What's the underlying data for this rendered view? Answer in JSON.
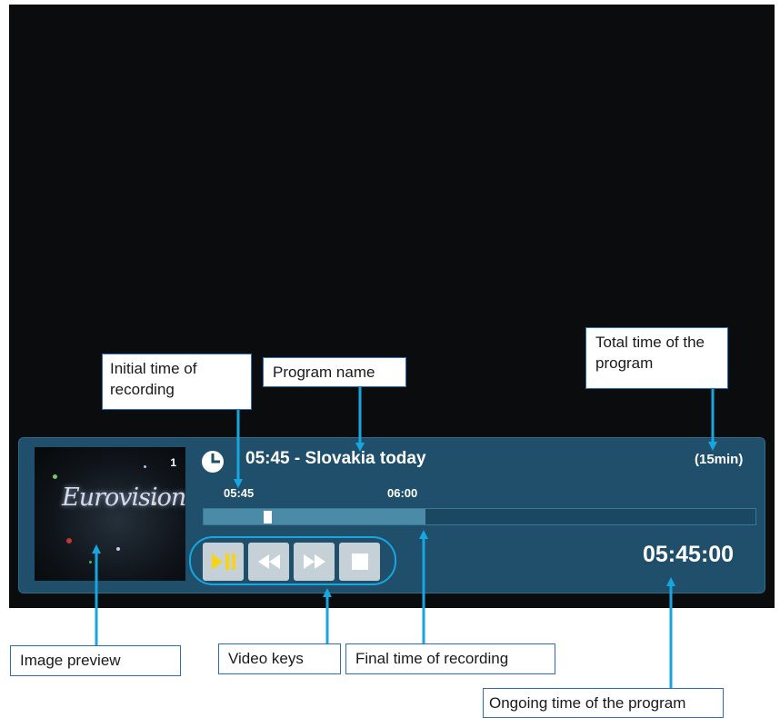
{
  "player": {
    "channel_number": "1",
    "preview_logo": "Eurovision",
    "program_title": "05:45 - Slovakia today",
    "duration": "(15min)",
    "start_time": "05:45",
    "end_time": "06:00",
    "current_time": "05:45:00",
    "recorded_fraction": 0.402,
    "position_fraction": 0.115,
    "keys": [
      {
        "name": "play-pause",
        "icon": "play-pause-icon",
        "color": "#f7d417"
      },
      {
        "name": "rewind",
        "icon": "rewind-icon",
        "color": "#ffffff"
      },
      {
        "name": "fast-forward",
        "icon": "fast-forward-icon",
        "color": "#ffffff"
      },
      {
        "name": "stop",
        "icon": "stop-icon",
        "color": "#ffffff"
      }
    ]
  },
  "annotations": {
    "initial_time": "Initial time of recording",
    "program_name": "Program name",
    "total_time": "Total time of the program",
    "image_preview": "Image preview",
    "video_keys": "Video keys",
    "final_time": "Final time of recording",
    "ongoing_time": "Ongoing time of the program"
  },
  "colors": {
    "panel": "#1f4f6a",
    "accent": "#18a6e0",
    "label_border": "#2f6fb0"
  }
}
